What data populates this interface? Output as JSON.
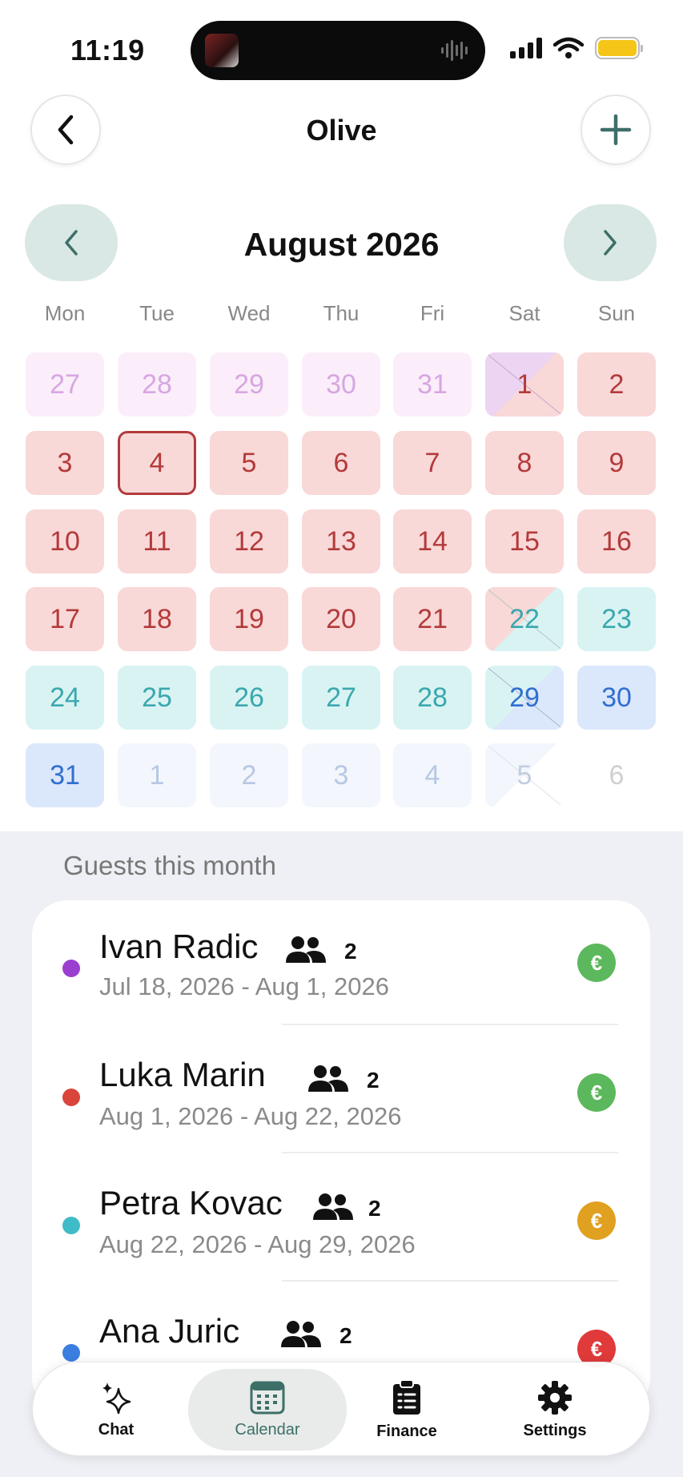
{
  "status": {
    "time": "11:19"
  },
  "header": {
    "title": "Olive"
  },
  "calendar": {
    "month_title": "August 2026",
    "weekdays": [
      "Mon",
      "Tue",
      "Wed",
      "Thu",
      "Fri",
      "Sat",
      "Sun"
    ],
    "days": [
      "27",
      "28",
      "29",
      "30",
      "31",
      "1",
      "2",
      "3",
      "4",
      "5",
      "6",
      "7",
      "8",
      "9",
      "10",
      "11",
      "12",
      "13",
      "14",
      "15",
      "16",
      "17",
      "18",
      "19",
      "20",
      "21",
      "22",
      "23",
      "24",
      "25",
      "26",
      "27",
      "28",
      "29",
      "30",
      "31",
      "1",
      "2",
      "3",
      "4",
      "5",
      "6"
    ],
    "today": "4"
  },
  "guests_section": {
    "title": "Guests this month",
    "guests": [
      {
        "name": "Ivan Radic",
        "count": "2",
        "dates": "Jul 18, 2026 - Aug 1, 2026",
        "dot_color": "#9b3fd0",
        "badge": "€",
        "badge_color": "#5cb85c"
      },
      {
        "name": "Luka Marin",
        "count": "2",
        "dates": "Aug 1, 2026 - Aug 22, 2026",
        "dot_color": "#d9443b",
        "badge": "€",
        "badge_color": "#5cb85c"
      },
      {
        "name": "Petra Kovac",
        "count": "2",
        "dates": "Aug 22, 2026 - Aug 29, 2026",
        "dot_color": "#3fbcc8",
        "badge": "€",
        "badge_color": "#e0a020"
      },
      {
        "name": "Ana Juric",
        "count": "2",
        "dates": "",
        "dot_color": "#3a7ee0",
        "badge": "€",
        "badge_color": "#e03a3a"
      }
    ]
  },
  "tabbar": {
    "tabs": [
      {
        "label": "Chat",
        "icon": "sparkles-icon"
      },
      {
        "label": "Calendar",
        "icon": "calendar-icon",
        "active": true
      },
      {
        "label": "Finance",
        "icon": "clipboard-icon"
      },
      {
        "label": "Settings",
        "icon": "gear-icon"
      }
    ]
  },
  "colors": {
    "accent": "#3d6f68",
    "booked_red_bg": "#f9d8d8",
    "booked_red_text": "#b33a3a",
    "teal_bg": "#d9f3f3",
    "teal_text": "#3aa8ae",
    "blue_bg": "#dbe7fb",
    "blue_text": "#2f6fd1"
  }
}
